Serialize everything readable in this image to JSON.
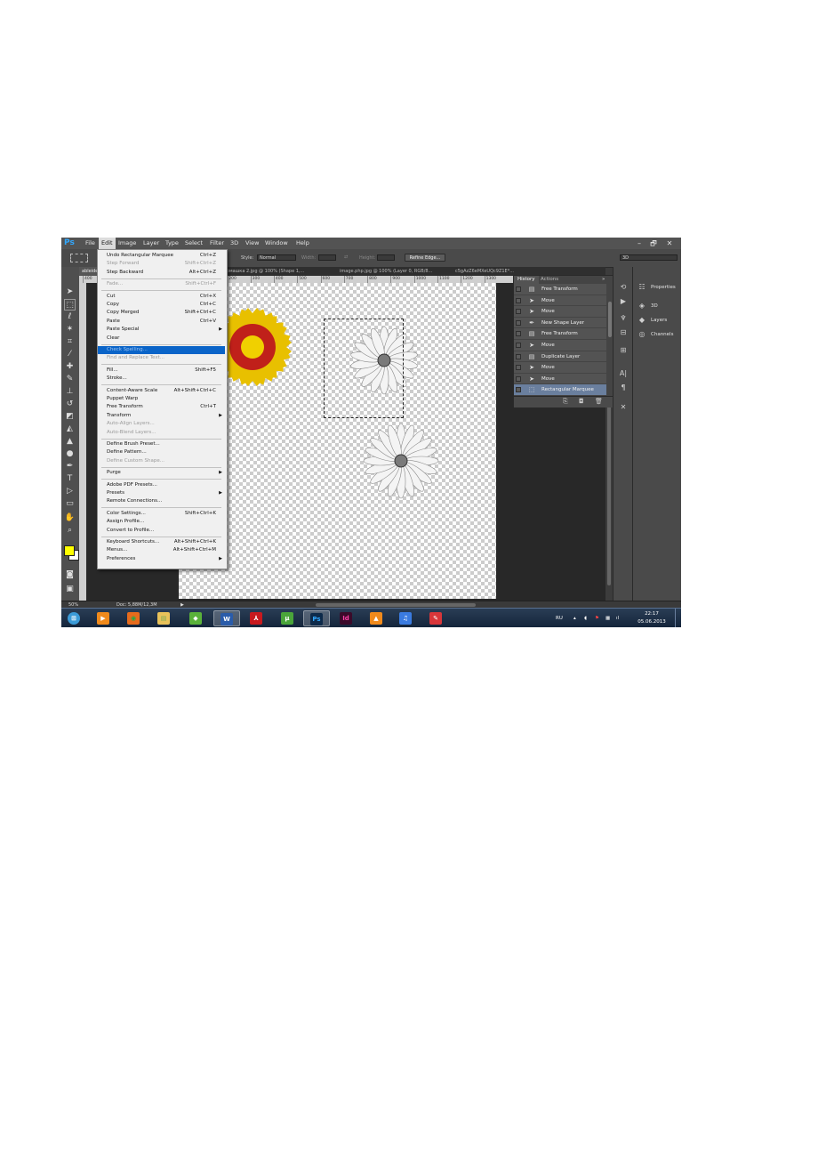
{
  "app": {
    "logo": "Ps",
    "menus": [
      "File",
      "Edit",
      "Image",
      "Layer",
      "Type",
      "Select",
      "Filter",
      "3D",
      "View",
      "Window",
      "Help"
    ],
    "open_menu": "Edit",
    "window_controls": {
      "minimize": "–",
      "restore": "🗗",
      "close": "✕"
    }
  },
  "options_bar": {
    "style_label": "Style:",
    "style_value": "Normal",
    "width_label": "Width:",
    "height_label": "Height:",
    "refine_button": "Refine Edge...",
    "workspace": "3D"
  },
  "doc_tabs": [
    {
      "label": "ableide.hf...",
      "active": true
    },
    {
      "label": "e ромашка 2.jpg @ 100% (Shape 1,...",
      "active": false
    },
    {
      "label": "image.php.jpg @ 100% (Layer 0, RGB/8...",
      "active": false
    },
    {
      "label": "c5gAzZ6eMXeUQc9Z1E*...",
      "active": false
    }
  ],
  "ruler_ticks": [
    "400",
    "100",
    "200",
    "300",
    "400",
    "500",
    "600",
    "700",
    "800",
    "900",
    "1000",
    "1100",
    "1200",
    "1300"
  ],
  "edit_menu": [
    {
      "label": "Undo Rectangular Marquee",
      "shortcut": "Ctrl+Z",
      "disabled": false
    },
    {
      "label": "Step Forward",
      "shortcut": "Shift+Ctrl+Z",
      "disabled": true
    },
    {
      "label": "Step Backward",
      "shortcut": "Alt+Ctrl+Z",
      "disabled": false
    },
    {
      "sep": true
    },
    {
      "label": "Fade...",
      "shortcut": "Shift+Ctrl+F",
      "disabled": true
    },
    {
      "sep": true
    },
    {
      "label": "Cut",
      "shortcut": "Ctrl+X",
      "disabled": false
    },
    {
      "label": "Copy",
      "shortcut": "Ctrl+C",
      "disabled": false
    },
    {
      "label": "Copy Merged",
      "shortcut": "Shift+Ctrl+C",
      "disabled": false
    },
    {
      "label": "Paste",
      "shortcut": "Ctrl+V",
      "disabled": false
    },
    {
      "label": "Paste Special",
      "shortcut": "",
      "disabled": false,
      "submenu": true
    },
    {
      "label": "Clear",
      "shortcut": "",
      "disabled": false
    },
    {
      "sep": true
    },
    {
      "label": "Check Spelling...",
      "shortcut": "",
      "disabled": true,
      "highlight": true
    },
    {
      "label": "Find and Replace Text...",
      "shortcut": "",
      "disabled": true
    },
    {
      "sep": true
    },
    {
      "label": "Fill...",
      "shortcut": "Shift+F5",
      "disabled": false
    },
    {
      "label": "Stroke...",
      "shortcut": "",
      "disabled": false
    },
    {
      "sep": true
    },
    {
      "label": "Content-Aware Scale",
      "shortcut": "Alt+Shift+Ctrl+C",
      "disabled": false
    },
    {
      "label": "Puppet Warp",
      "shortcut": "",
      "disabled": false
    },
    {
      "label": "Free Transform",
      "shortcut": "Ctrl+T",
      "disabled": false
    },
    {
      "label": "Transform",
      "shortcut": "",
      "disabled": false,
      "submenu": true
    },
    {
      "label": "Auto-Align Layers...",
      "shortcut": "",
      "disabled": true
    },
    {
      "label": "Auto-Blend Layers...",
      "shortcut": "",
      "disabled": true
    },
    {
      "sep": true
    },
    {
      "label": "Define Brush Preset...",
      "shortcut": "",
      "disabled": false
    },
    {
      "label": "Define Pattern...",
      "shortcut": "",
      "disabled": false
    },
    {
      "label": "Define Custom Shape...",
      "shortcut": "",
      "disabled": true
    },
    {
      "sep": true
    },
    {
      "label": "Purge",
      "shortcut": "",
      "disabled": false,
      "submenu": true
    },
    {
      "sep": true
    },
    {
      "label": "Adobe PDF Presets...",
      "shortcut": "",
      "disabled": false
    },
    {
      "label": "Presets",
      "shortcut": "",
      "disabled": false,
      "submenu": true
    },
    {
      "label": "Remote Connections...",
      "shortcut": "",
      "disabled": false
    },
    {
      "sep": true
    },
    {
      "label": "Color Settings...",
      "shortcut": "Shift+Ctrl+K",
      "disabled": false
    },
    {
      "label": "Assign Profile...",
      "shortcut": "",
      "disabled": false
    },
    {
      "label": "Convert to Profile...",
      "shortcut": "",
      "disabled": false
    },
    {
      "sep": true
    },
    {
      "label": "Keyboard Shortcuts...",
      "shortcut": "Alt+Shift+Ctrl+K",
      "disabled": false
    },
    {
      "label": "Menus...",
      "shortcut": "Alt+Shift+Ctrl+M",
      "disabled": false
    },
    {
      "label": "Preferences",
      "shortcut": "",
      "disabled": false,
      "submenu": true
    }
  ],
  "history_panel": {
    "tabs": [
      "History",
      "Actions"
    ],
    "items": [
      {
        "label": "Free Transform",
        "icon": "transform-icon"
      },
      {
        "label": "Move",
        "icon": "move-icon"
      },
      {
        "label": "Move",
        "icon": "move-icon"
      },
      {
        "label": "New Shape Layer",
        "icon": "pen-icon"
      },
      {
        "label": "Free Transform",
        "icon": "transform-icon"
      },
      {
        "label": "Move",
        "icon": "move-icon"
      },
      {
        "label": "Duplicate Layer",
        "icon": "transform-icon"
      },
      {
        "label": "Move",
        "icon": "move-icon"
      },
      {
        "label": "Move",
        "icon": "move-icon"
      },
      {
        "label": "Rectangular Marquee",
        "icon": "marquee-icon",
        "active": true
      }
    ]
  },
  "right_panels": [
    "Properties",
    "3D",
    "Layers",
    "Channels"
  ],
  "status": {
    "zoom": "50%",
    "doc": "Doc: 5,88M/12,3M"
  },
  "taskbar": {
    "apps": [
      "start",
      "media-player",
      "firefox",
      "explorer",
      "corel",
      "word",
      "acrobat",
      "utorrent",
      "photoshop",
      "indesign",
      "vlc",
      "itunes",
      "paint"
    ],
    "lang": "RU",
    "time": "22:17",
    "date": "05.06.2013"
  },
  "colors": {
    "foreground": "#ffff00",
    "background": "#ffffff",
    "accent": "#0a64c8"
  }
}
